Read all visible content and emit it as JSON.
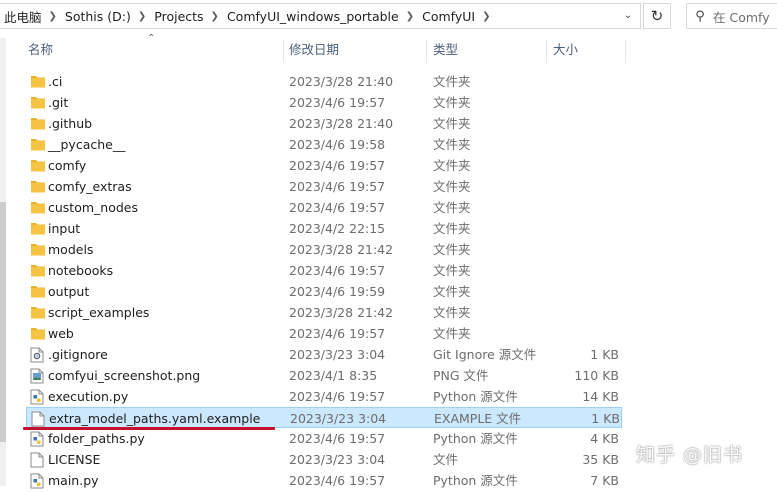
{
  "breadcrumb": [
    "此电脑",
    "Sothis (D:)",
    "Projects",
    "ComfyUI_windows_portable",
    "ComfyUI"
  ],
  "search": {
    "placeholder": "在 Comfy"
  },
  "columns": {
    "name": "名称",
    "date": "修改日期",
    "type": "类型",
    "size": "大小"
  },
  "files": [
    {
      "name": ".ci",
      "date": "2023/3/28 21:40",
      "type": "文件夹",
      "size": "",
      "icon": "folder"
    },
    {
      "name": ".git",
      "date": "2023/4/6 19:57",
      "type": "文件夹",
      "size": "",
      "icon": "folder"
    },
    {
      "name": ".github",
      "date": "2023/3/28 21:40",
      "type": "文件夹",
      "size": "",
      "icon": "folder"
    },
    {
      "name": "__pycache__",
      "date": "2023/4/6 19:58",
      "type": "文件夹",
      "size": "",
      "icon": "folder"
    },
    {
      "name": "comfy",
      "date": "2023/4/6 19:57",
      "type": "文件夹",
      "size": "",
      "icon": "folder"
    },
    {
      "name": "comfy_extras",
      "date": "2023/4/6 19:57",
      "type": "文件夹",
      "size": "",
      "icon": "folder"
    },
    {
      "name": "custom_nodes",
      "date": "2023/4/6 19:57",
      "type": "文件夹",
      "size": "",
      "icon": "folder"
    },
    {
      "name": "input",
      "date": "2023/4/2 22:15",
      "type": "文件夹",
      "size": "",
      "icon": "folder"
    },
    {
      "name": "models",
      "date": "2023/3/28 21:42",
      "type": "文件夹",
      "size": "",
      "icon": "folder"
    },
    {
      "name": "notebooks",
      "date": "2023/4/6 19:57",
      "type": "文件夹",
      "size": "",
      "icon": "folder"
    },
    {
      "name": "output",
      "date": "2023/4/6 19:59",
      "type": "文件夹",
      "size": "",
      "icon": "folder"
    },
    {
      "name": "script_examples",
      "date": "2023/3/28 21:42",
      "type": "文件夹",
      "size": "",
      "icon": "folder"
    },
    {
      "name": "web",
      "date": "2023/4/6 19:57",
      "type": "文件夹",
      "size": "",
      "icon": "folder"
    },
    {
      "name": ".gitignore",
      "date": "2023/3/23 3:04",
      "type": "Git Ignore 源文件",
      "size": "1 KB",
      "icon": "gear-file"
    },
    {
      "name": "comfyui_screenshot.png",
      "date": "2023/4/1 8:35",
      "type": "PNG 文件",
      "size": "110 KB",
      "icon": "image-file"
    },
    {
      "name": "execution.py",
      "date": "2023/4/6 19:57",
      "type": "Python 源文件",
      "size": "14 KB",
      "icon": "python-file"
    },
    {
      "name": "extra_model_paths.yaml.example",
      "date": "2023/3/23 3:04",
      "type": "EXAMPLE 文件",
      "size": "1 KB",
      "icon": "blank-file",
      "selected": true
    },
    {
      "name": "folder_paths.py",
      "date": "2023/4/6 19:57",
      "type": "Python 源文件",
      "size": "4 KB",
      "icon": "python-file"
    },
    {
      "name": "LICENSE",
      "date": "2023/3/23 3:04",
      "type": "文件",
      "size": "35 KB",
      "icon": "blank-file"
    },
    {
      "name": "main.py",
      "date": "2023/4/6 19:57",
      "type": "Python 源文件",
      "size": "7 KB",
      "icon": "python-file"
    }
  ],
  "watermark": "知乎 @旧书",
  "colors": {
    "selection": "#cce8ff",
    "folder": "#f6c342",
    "annotation": "#c8102e"
  }
}
